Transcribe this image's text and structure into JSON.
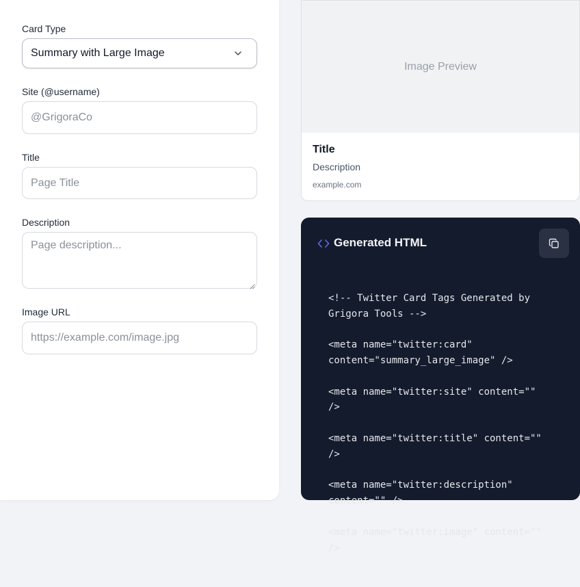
{
  "form": {
    "card_type": {
      "label": "Card Type",
      "selected": "Summary with Large Image"
    },
    "site": {
      "label": "Site (@username)",
      "placeholder": "@GrigoraCo"
    },
    "title": {
      "label": "Title",
      "placeholder": "Page Title"
    },
    "description": {
      "label": "Description",
      "placeholder": "Page description..."
    },
    "image_url": {
      "label": "Image URL",
      "placeholder": "https://example.com/image.jpg"
    }
  },
  "preview": {
    "image_placeholder": "Image Preview",
    "title": "Title",
    "description": "Description",
    "domain": "example.com"
  },
  "code_panel": {
    "title": "Generated HTML",
    "lines": [
      "<!-- Twitter Card Tags Generated by Grigora Tools -->",
      "<meta name=\"twitter:card\" content=\"summary_large_image\" />",
      "<meta name=\"twitter:site\" content=\"\" />",
      "<meta name=\"twitter:title\" content=\"\" />",
      "<meta name=\"twitter:description\" content=\"\" />",
      "<meta name=\"twitter:image\" content=\"\" />"
    ]
  },
  "colors": {
    "accent": "#6366f1",
    "code_bg": "#141b2d",
    "copy_button_bg": "#2a3142"
  },
  "icons": {
    "select_arrow": "chevron-down-icon",
    "code": "code-brackets-icon",
    "copy": "copy-icon"
  }
}
